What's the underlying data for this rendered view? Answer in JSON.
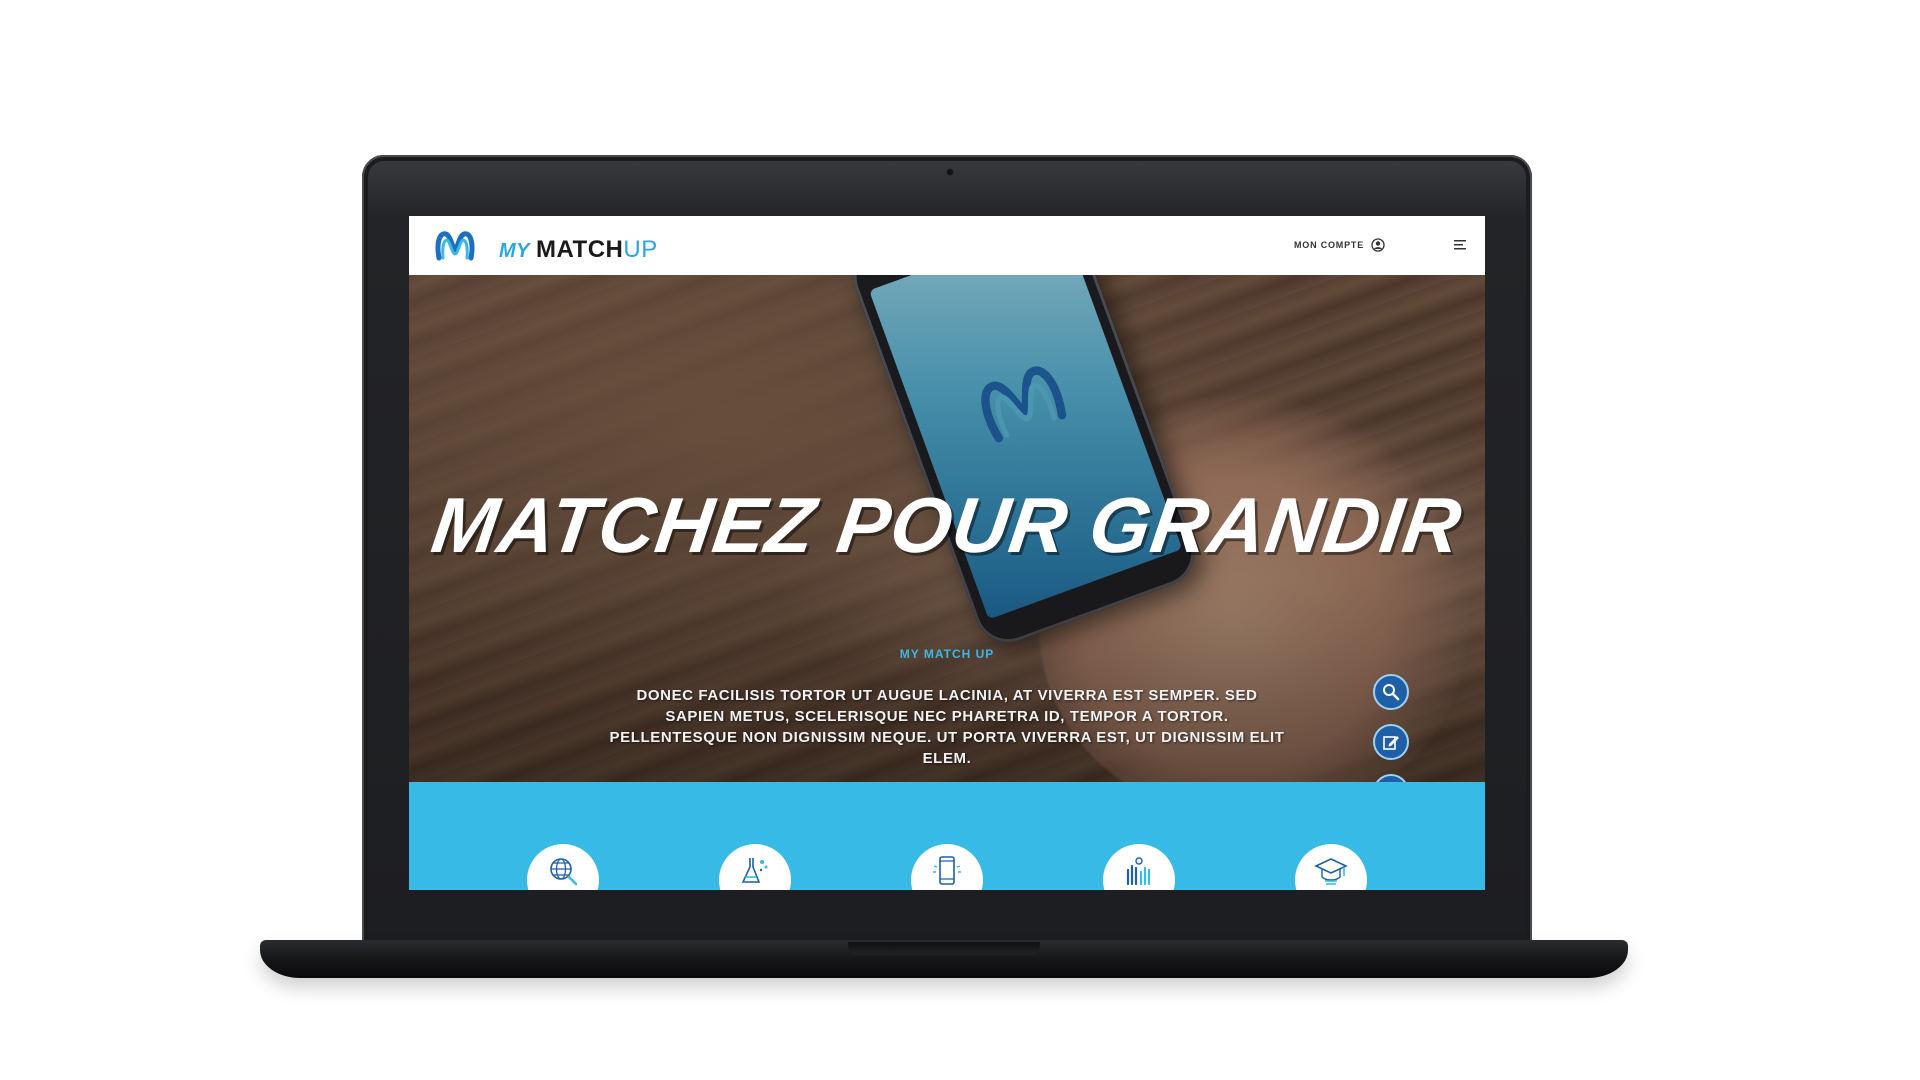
{
  "header": {
    "brand_my": "MY",
    "brand_match": "MATCH",
    "brand_up": "UP",
    "account_label": "MON COMPTE"
  },
  "hero": {
    "title": "MATCHEZ POUR GRANDIR",
    "subtitle": "MY MATCH UP",
    "body": "DONEC FACILISIS TORTOR UT AUGUE LACINIA, AT VIVERRA EST SEMPER. SED SAPIEN METUS, SCELERISQUE NEC PHARETRA ID, TEMPOR A TORTOR. PELLENTESQUE NON DIGNISSIM NEQUE. UT PORTA VIVERRA EST, UT DIGNISSIM ELIT ELEM."
  },
  "floating_actions": [
    {
      "icon": "search-icon"
    },
    {
      "icon": "edit-icon"
    },
    {
      "icon": "help-icon"
    }
  ],
  "features": [
    {
      "icon": "globe-search-icon"
    },
    {
      "icon": "lab-flask-icon"
    },
    {
      "icon": "smartphone-icon"
    },
    {
      "icon": "hands-icon"
    },
    {
      "icon": "graduation-cap-icon"
    }
  ],
  "colors": {
    "brand_blue": "#2aa8de",
    "band_blue": "#37bae5",
    "fab_blue": "#1f5fa8",
    "laptop_bezel": "#1d1e21"
  }
}
